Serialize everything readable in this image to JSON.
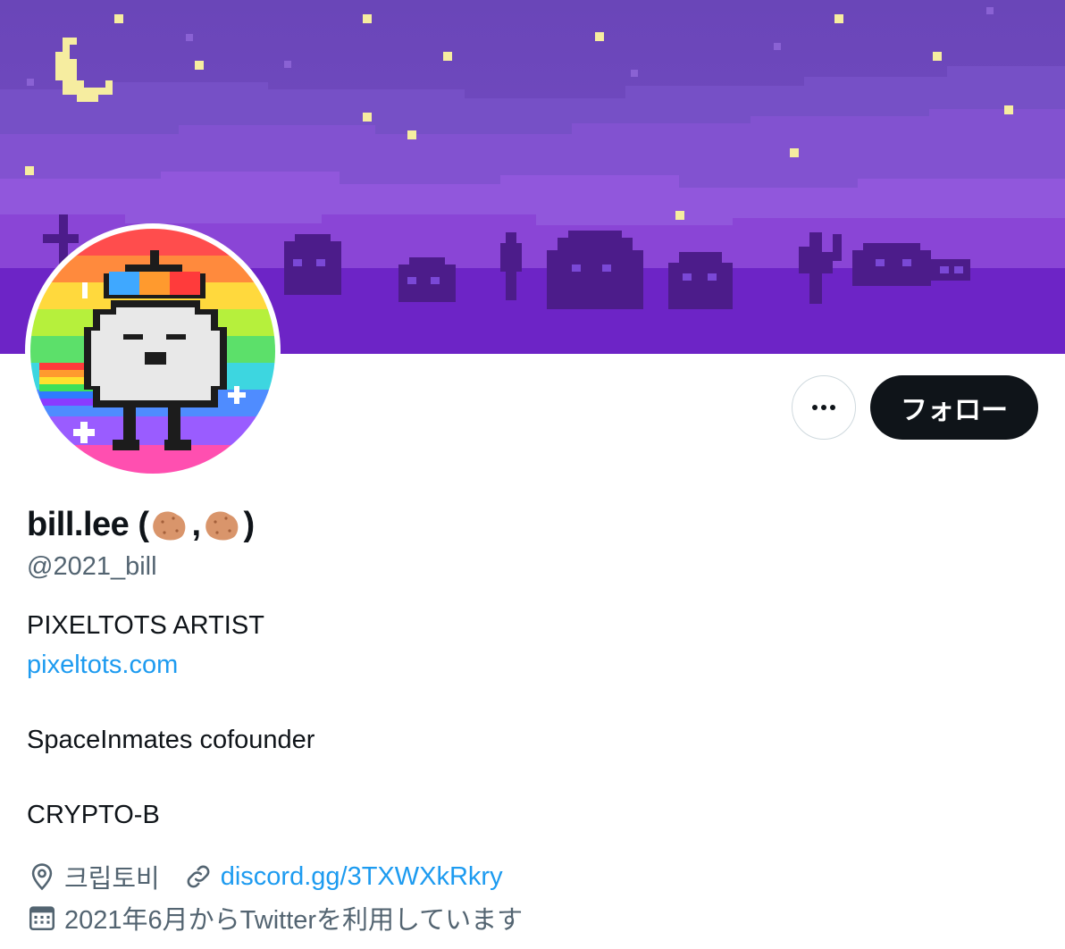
{
  "profile": {
    "display_name": "bill.lee (",
    "name_separator": ",",
    "name_close": ")",
    "name_emoji": "potato",
    "handle": "@2021_bill"
  },
  "actions": {
    "more_label": "…",
    "follow_label": "フォロー"
  },
  "bio": {
    "line1": "PIXELTOTS ARTIST",
    "link": "pixeltots.com",
    "line2": "SpaceInmates cofounder",
    "line3": "CRYPTO-B"
  },
  "meta": {
    "location": "크립토비",
    "website": "discord.gg/3TXWXkRkry",
    "joined": "2021年6月からTwitterを利用しています"
  },
  "colors": {
    "accent": "#1d9bf0",
    "primary_text": "#0f1419",
    "secondary_text": "#536471",
    "banner": "#6e48bd"
  },
  "icons": [
    "location-icon",
    "link-icon",
    "calendar-icon",
    "more-icon",
    "potato-emoji"
  ]
}
